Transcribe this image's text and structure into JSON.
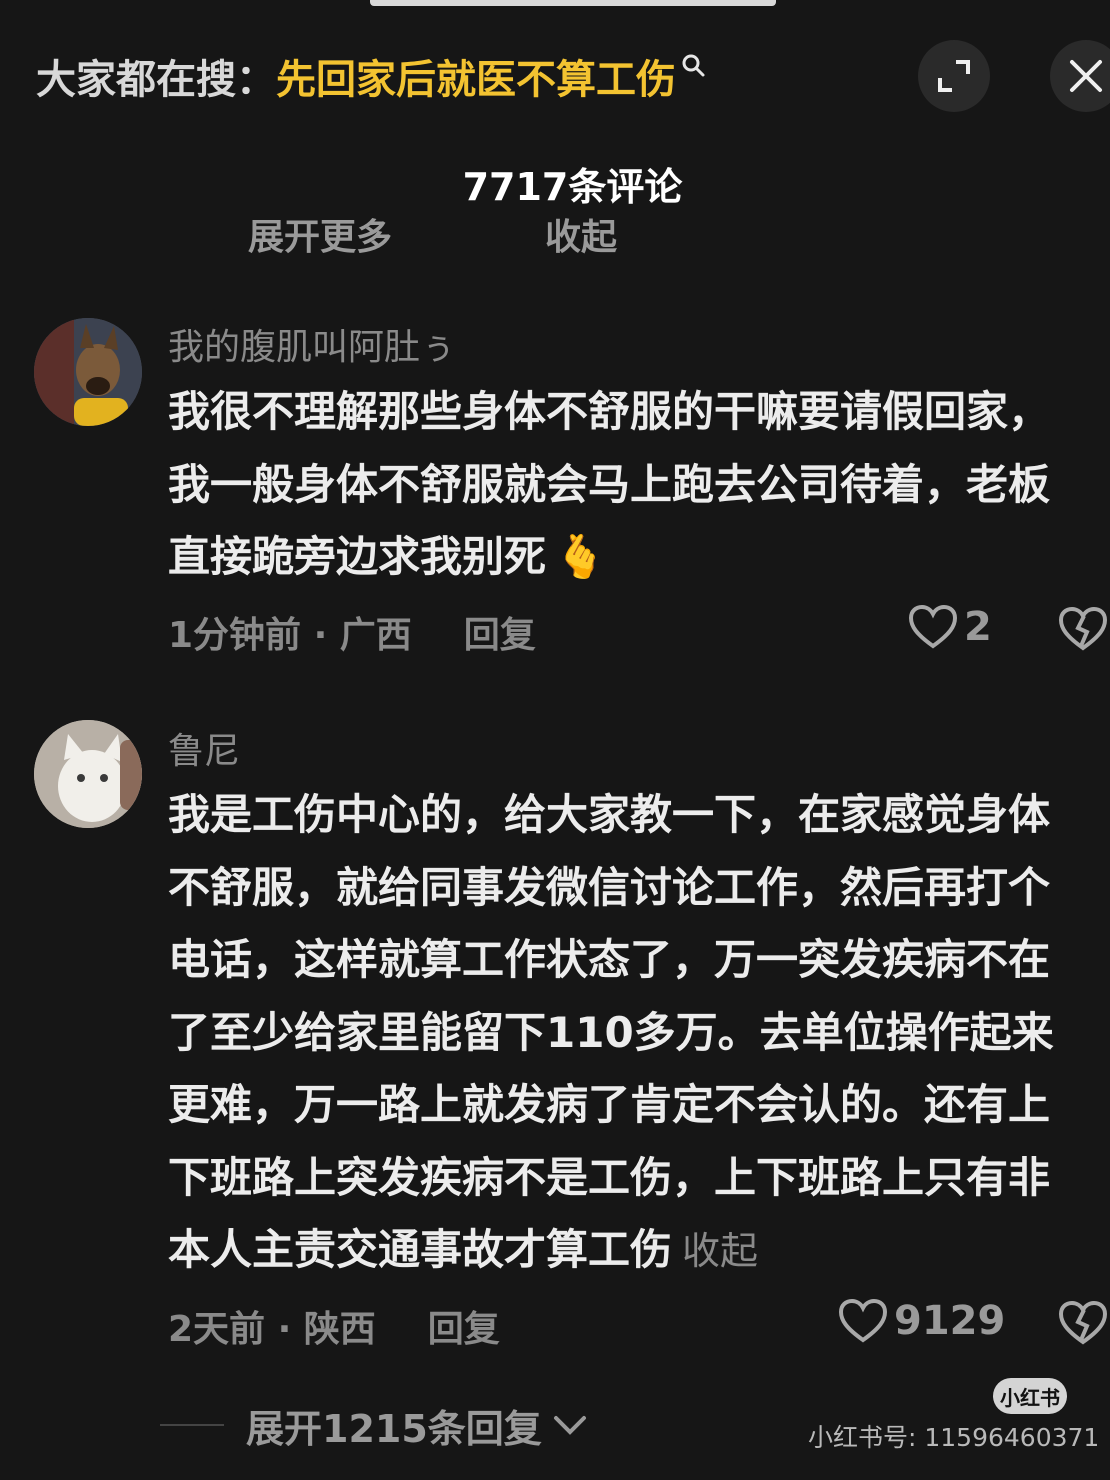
{
  "search": {
    "prefix": "大家都在搜：",
    "term": "先回家后就医不算工伤"
  },
  "header": {
    "comment_count": "7717条评论",
    "clipped_left": "展开更多",
    "clipped_right": "收起"
  },
  "comments": [
    {
      "username": "我的腹肌叫阿肚ぅ",
      "text": "我很不理解那些身体不舒服的干嘛要请假回家，我一般身体不舒服就会马上跑去公司待着，老板直接跪旁边求我别死",
      "emoji": "🫰",
      "time_location": "1分钟前 · 广西",
      "reply_label": "回复",
      "likes": "2"
    },
    {
      "username": "鲁尼",
      "text": "我是工伤中心的，给大家教一下，在家感觉身体不舒服，就给同事发微信讨论工作，然后再打个电话，这样就算工作状态了，万一突发疾病不在了至少给家里能留下110多万。去单位操作起来更难，万一路上就发病了肯定不会认的。还有上下班路上突发疾病不是工伤，上下班路上只有非本人主责交通事故才算工伤",
      "collapse_label": "收起",
      "time_location": "2天前 · 陕西",
      "reply_label": "回复",
      "likes": "9129"
    }
  ],
  "footer": {
    "expand_replies": "展开1215条回复",
    "watermark_logo": "小红书",
    "watermark_text": "小红书号: 11596460371"
  },
  "colors": {
    "background": "#161616",
    "search_term": "#f3c331",
    "muted": "#8a8a8a"
  }
}
